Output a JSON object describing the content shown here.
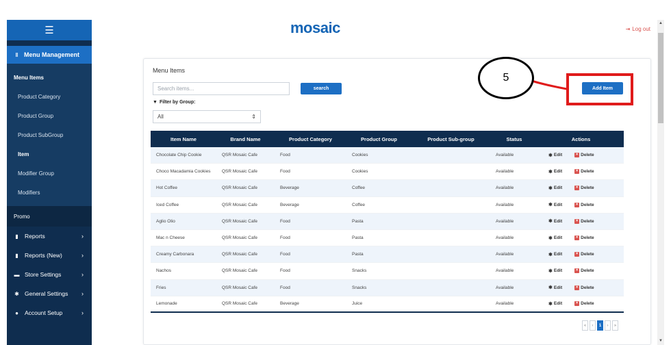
{
  "header": {
    "logo": "mosaic",
    "logout_label": "Log out"
  },
  "sidebar": {
    "menu_management": "Menu Management",
    "sub_items": [
      {
        "label": "Menu Items"
      },
      {
        "label": "Product Category"
      },
      {
        "label": "Product Group"
      },
      {
        "label": "Product SubGroup"
      },
      {
        "label": "Item"
      },
      {
        "label": "Modifier Group"
      },
      {
        "label": "Modifiers"
      }
    ],
    "promo": "Promo",
    "items": [
      {
        "label": "Reports",
        "icon": "report-icon"
      },
      {
        "label": "Reports (New)",
        "icon": "report-icon"
      },
      {
        "label": "Store Settings",
        "icon": "store-icon"
      },
      {
        "label": "General Settings",
        "icon": "gear-icon"
      },
      {
        "label": "Account Setup",
        "icon": "user-icon"
      }
    ]
  },
  "main": {
    "title": "Menu Items",
    "search_placeholder": "Search items...",
    "search_button": "search",
    "filter_label": "Filter by Group:",
    "filter_value": "All",
    "add_button": "Add Item",
    "columns": [
      "Item Name",
      "Brand Name",
      "Product Category",
      "Product Group",
      "Product Sub-group",
      "Status",
      "Actions"
    ],
    "edit_label": "Edit",
    "delete_label": "Delete",
    "rows": [
      {
        "name": "Chocolate Chip Cookie",
        "brand": "QSR Mosaic Cafe",
        "category": "Food",
        "group": "Cookies",
        "subgroup": "",
        "status": "Available"
      },
      {
        "name": "Choco Macadamia Cookies",
        "brand": "QSR Mosaic Cafe",
        "category": "Food",
        "group": "Cookies",
        "subgroup": "",
        "status": "Available"
      },
      {
        "name": "Hot Coffee",
        "brand": "QSR Mosaic Cafe",
        "category": "Beverage",
        "group": "Coffee",
        "subgroup": "",
        "status": "Available"
      },
      {
        "name": "Iced Coffee",
        "brand": "QSR Mosaic Cafe",
        "category": "Beverage",
        "group": "Coffee",
        "subgroup": "",
        "status": "Available"
      },
      {
        "name": "Aglio Olio",
        "brand": "QSR Mosaic Cafe",
        "category": "Food",
        "group": "Pasta",
        "subgroup": "",
        "status": "Available"
      },
      {
        "name": "Mac n Cheese",
        "brand": "QSR Mosaic Cafe",
        "category": "Food",
        "group": "Pasta",
        "subgroup": "",
        "status": "Available"
      },
      {
        "name": "Creamy Carbonara",
        "brand": "QSR Mosaic Cafe",
        "category": "Food",
        "group": "Pasta",
        "subgroup": "",
        "status": "Available"
      },
      {
        "name": "Nachos",
        "brand": "QSR Mosaic Cafe",
        "category": "Food",
        "group": "Snacks",
        "subgroup": "",
        "status": "Available"
      },
      {
        "name": "Fries",
        "brand": "QSR Mosaic Cafe",
        "category": "Food",
        "group": "Snacks",
        "subgroup": "",
        "status": "Available"
      },
      {
        "name": "Lemonade",
        "brand": "QSR Mosaic Cafe",
        "category": "Beverage",
        "group": "Juice",
        "subgroup": "",
        "status": "Available"
      }
    ],
    "pagination": {
      "first": "«",
      "prev": "‹",
      "current": "1",
      "next": "›",
      "last": "»"
    }
  },
  "annotation": {
    "step_number": "5",
    "color": "#e01b1b"
  }
}
